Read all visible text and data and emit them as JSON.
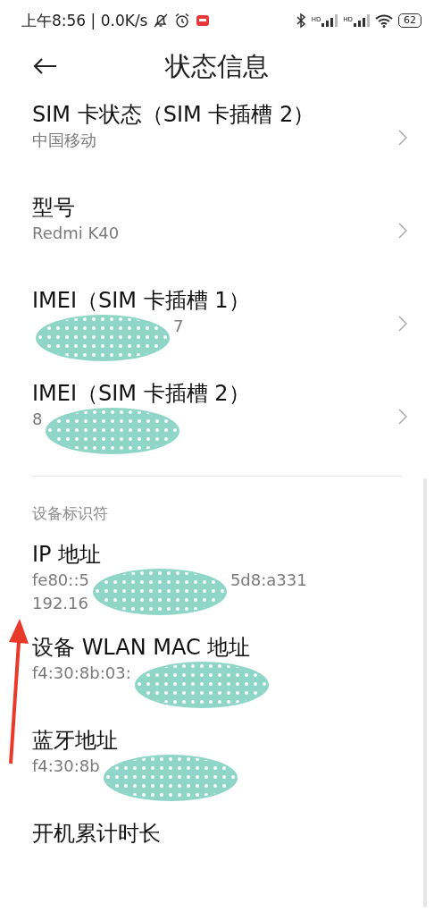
{
  "status_bar": {
    "time": "上午8:56 | 0.0K/s",
    "signal_labels": [
      "HD",
      "HD"
    ],
    "battery": "62"
  },
  "header": {
    "title": "状态信息"
  },
  "items": [
    {
      "title": "SIM 卡状态（SIM 卡插槽 2）",
      "lines": [
        {
          "before": "中国移动"
        }
      ]
    },
    {
      "title": "型号",
      "lines": [
        {
          "before": "Redmi K40"
        }
      ]
    },
    {
      "title": "IMEI（SIM 卡插槽 1）",
      "lines": [
        {
          "after": "7"
        }
      ],
      "masked": true
    },
    {
      "title": "IMEI（SIM 卡插槽 2）",
      "lines": [
        {
          "before": "8"
        }
      ],
      "masked": true
    }
  ],
  "section": {
    "title": "设备标识符",
    "items": [
      {
        "title": "IP 地址",
        "lines": [
          {
            "before": "fe80::5",
            "after": "5d8:a331"
          },
          {
            "before": "192.16"
          }
        ],
        "masked": true
      },
      {
        "title": "设备 WLAN MAC 地址",
        "lines": [
          {
            "before": "f4:30:8b:03:"
          }
        ],
        "masked": true
      },
      {
        "title": "蓝牙地址",
        "lines": [
          {
            "before": "f4:30:8b"
          }
        ],
        "masked": true
      },
      {
        "title": "开机累计时长"
      }
    ]
  }
}
